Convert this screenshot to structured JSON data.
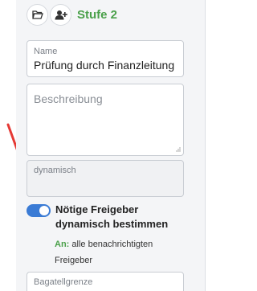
{
  "stage": {
    "title": "Stufe 2"
  },
  "icons": {
    "folder": "folder-open-icon",
    "add_user": "add-user-icon"
  },
  "name_field": {
    "label": "Name",
    "value": "Prüfung durch Finanzleitung"
  },
  "description_field": {
    "placeholder": "Beschreibung"
  },
  "dynamic_field": {
    "label": "dynamisch"
  },
  "toggle": {
    "label_line1": "Nötige Freigeber",
    "label_line2": "dynamisch bestimmen",
    "checked": true
  },
  "recipients": {
    "prefix": "An:",
    "text_line1": "alle benachrichtigten",
    "text_line2": "Freigeber"
  },
  "threshold_field": {
    "label": "Bagatellgrenze"
  },
  "colors": {
    "accent_green": "#4aa04a",
    "toggle_blue": "#3a7bd5",
    "arrow_red": "#e53935"
  }
}
